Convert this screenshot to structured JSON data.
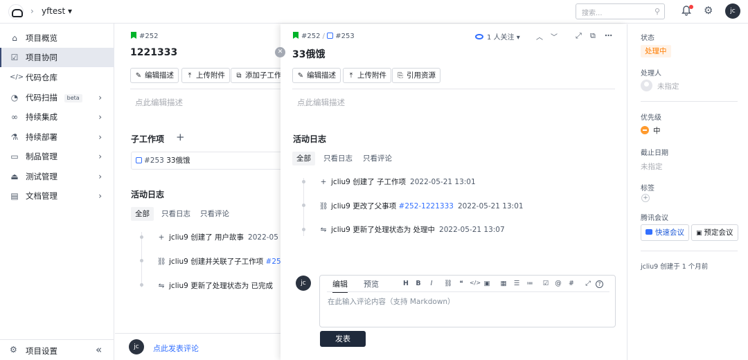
{
  "topbar": {
    "project_name": "yftest ▾",
    "search_placeholder": "搜索...",
    "user_initials": "jc"
  },
  "sidebar": {
    "items": [
      {
        "label": "项目概览",
        "icon": "home-icon"
      },
      {
        "label": "项目协同",
        "icon": "collab-icon",
        "active": true
      },
      {
        "label": "代码仓库",
        "icon": "code-icon"
      },
      {
        "label": "代码扫描",
        "icon": "scan-icon",
        "badge": "beta"
      },
      {
        "label": "持续集成",
        "icon": "infinity-icon"
      },
      {
        "label": "持续部署",
        "icon": "deploy-icon"
      },
      {
        "label": "制品管理",
        "icon": "package-icon"
      },
      {
        "label": "测试管理",
        "icon": "test-icon"
      },
      {
        "label": "文档管理",
        "icon": "doc-icon"
      }
    ],
    "settings_label": "项目设置",
    "collapse_glyph": "«"
  },
  "back_panel": {
    "issue_id": "#252",
    "title": "1221333",
    "buttons": [
      "编辑描述",
      "上传附件",
      "添加子工作项"
    ],
    "desc_placeholder": "点此编辑描述",
    "children_heading": "子工作项",
    "child_item": {
      "id": "#253",
      "title": "33俄饿"
    },
    "log_heading": "活动日志",
    "filters": [
      "全部",
      "只看日志",
      "只看评论"
    ],
    "logs": [
      {
        "text": "jcliu9 创建了 用户故事",
        "time": "2022-05"
      },
      {
        "text": "jcliu9 创建并关联了子工作项",
        "link": "#25"
      },
      {
        "text": "jcliu9 更新了处理状态为  已完成"
      }
    ],
    "comment_prompt": "点此发表评论",
    "user_initials": "jc"
  },
  "front_panel": {
    "parent_id": "#252",
    "separator": "/",
    "issue_id": "#253",
    "title": "33俄饿",
    "watchers": "1 人关注 ▾",
    "buttons": [
      "编辑描述",
      "上传附件",
      "引用资源"
    ],
    "desc_placeholder": "点此编辑描述",
    "log_heading": "活动日志",
    "filters": [
      "全部",
      "只看日志",
      "只看评论"
    ],
    "logs": [
      {
        "text": "jcliu9 创建了 子工作项",
        "time": "2022-05-21 13:01"
      },
      {
        "text": "jcliu9 更改了父事项",
        "link": "#252-1221333",
        "time": "2022-05-21 13:01"
      },
      {
        "text": "jcliu9 更新了处理状态为  处理中",
        "time": "2022-05-21 13:07"
      }
    ],
    "editor": {
      "tabs": [
        "编辑",
        "预览"
      ],
      "tools": [
        "H",
        "B",
        "I",
        "⛓",
        "❝",
        "</>",
        "▣",
        "▦",
        "☰",
        "≔",
        "☑",
        "@",
        "#",
        "⤢",
        "?"
      ],
      "placeholder": "在此输入评论内容（支持 Markdown）"
    },
    "submit_label": "发表",
    "user_initials": "jc"
  },
  "info_panel": {
    "status_label": "状态",
    "status_value": "处理中",
    "assignee_label": "处理人",
    "assignee_value": "未指定",
    "priority_label": "优先级",
    "priority_value": "中",
    "deadline_label": "截止日期",
    "deadline_value": "未指定",
    "tags_label": "标签",
    "meeting_label": "腾讯会议",
    "quick_meeting": "快速会议",
    "scheduled_meeting": "预定会议",
    "created_note": "jcliu9 创建于 1 个月前"
  },
  "colors": {
    "accent": "#3370ff",
    "status_orange": "#ff7d00",
    "dark_button": "#1f2a3c",
    "flag_green": "#00b42a"
  }
}
